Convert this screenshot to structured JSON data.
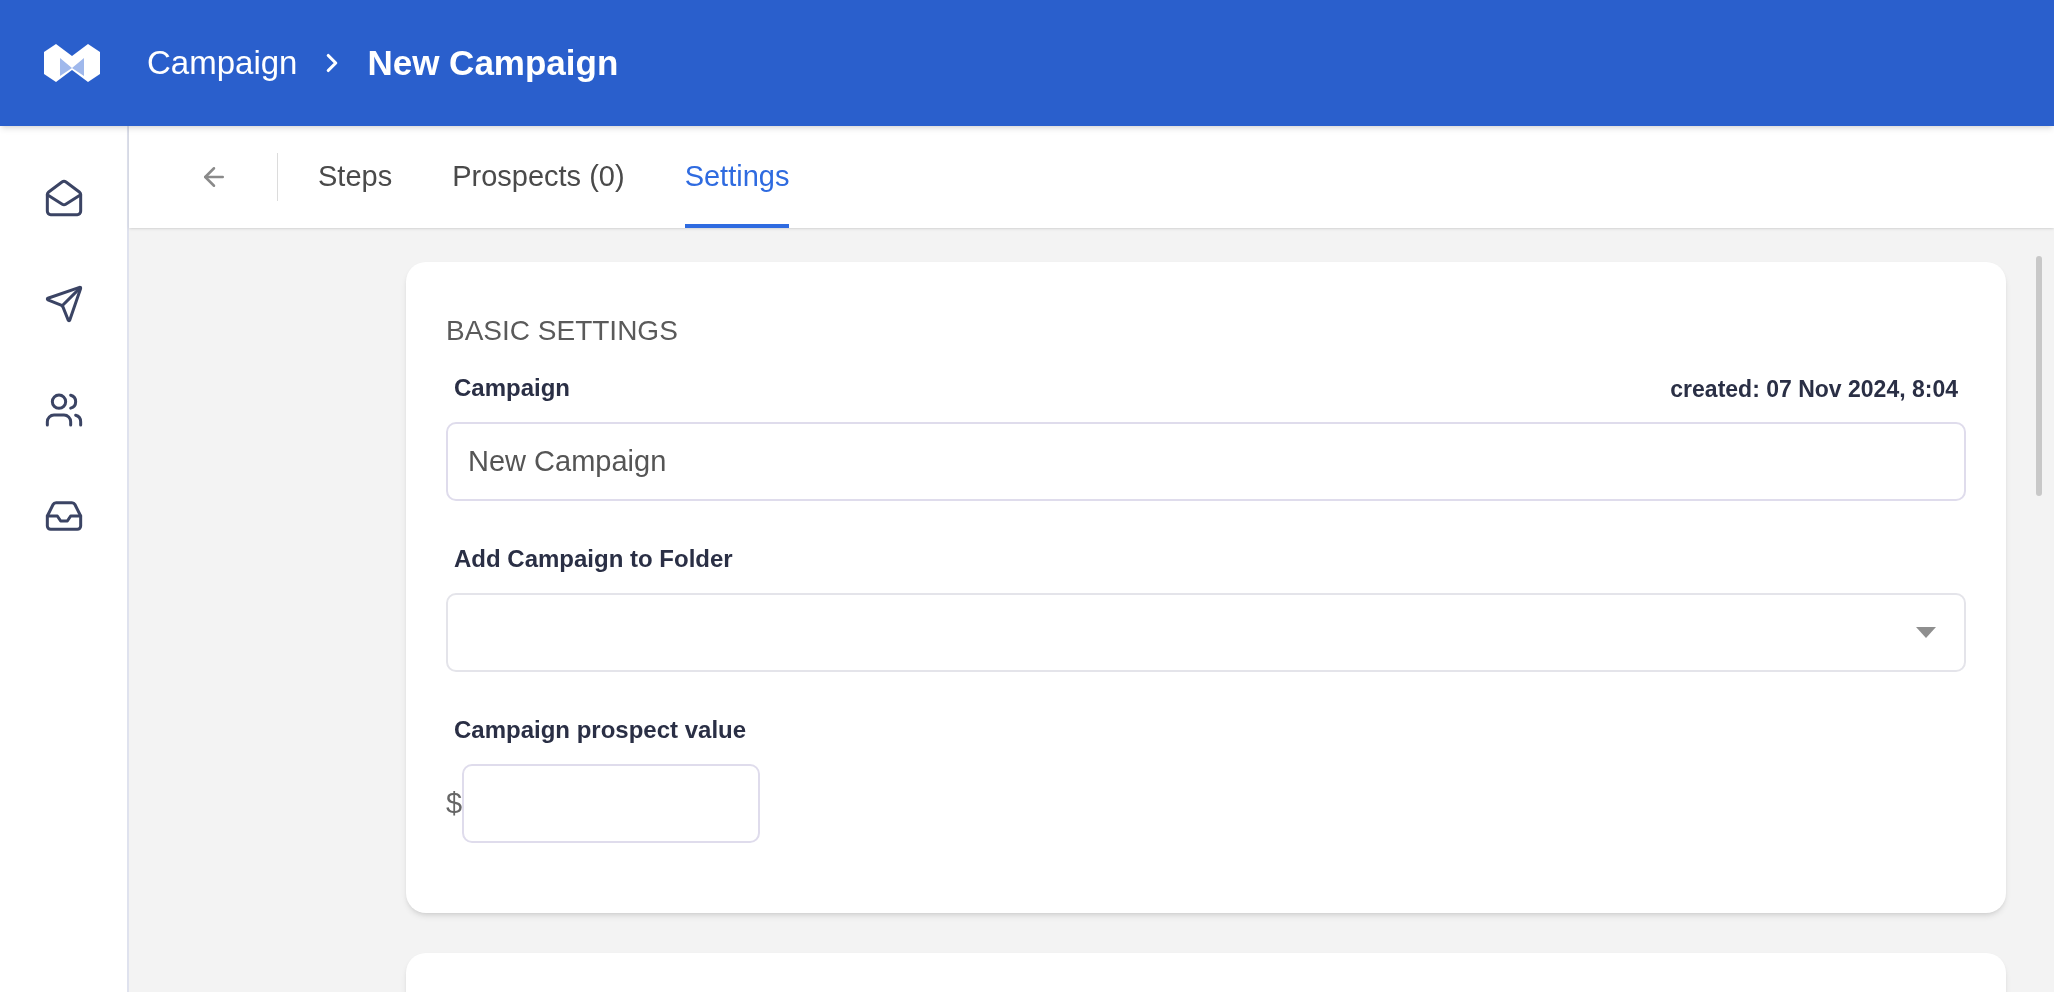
{
  "header": {
    "breadcrumb": "Campaign",
    "title": "New Campaign"
  },
  "sidebar": {
    "items": [
      {
        "kind": "mail"
      },
      {
        "kind": "send"
      },
      {
        "kind": "people"
      },
      {
        "kind": "inbox"
      }
    ]
  },
  "tabs": [
    {
      "label": "Steps",
      "selected": false
    },
    {
      "label": "Prospects (0)",
      "selected": false
    },
    {
      "label": "Settings",
      "selected": true
    }
  ],
  "basic_settings": {
    "heading": "BASIC SETTINGS",
    "campaign_label": "Campaign",
    "created": "created: 07 Nov 2024, 8:04",
    "campaign_value": "New Campaign",
    "folder_label": "Add Campaign to Folder",
    "prospect_value_label": "Campaign prospect value",
    "currency": "$"
  }
}
